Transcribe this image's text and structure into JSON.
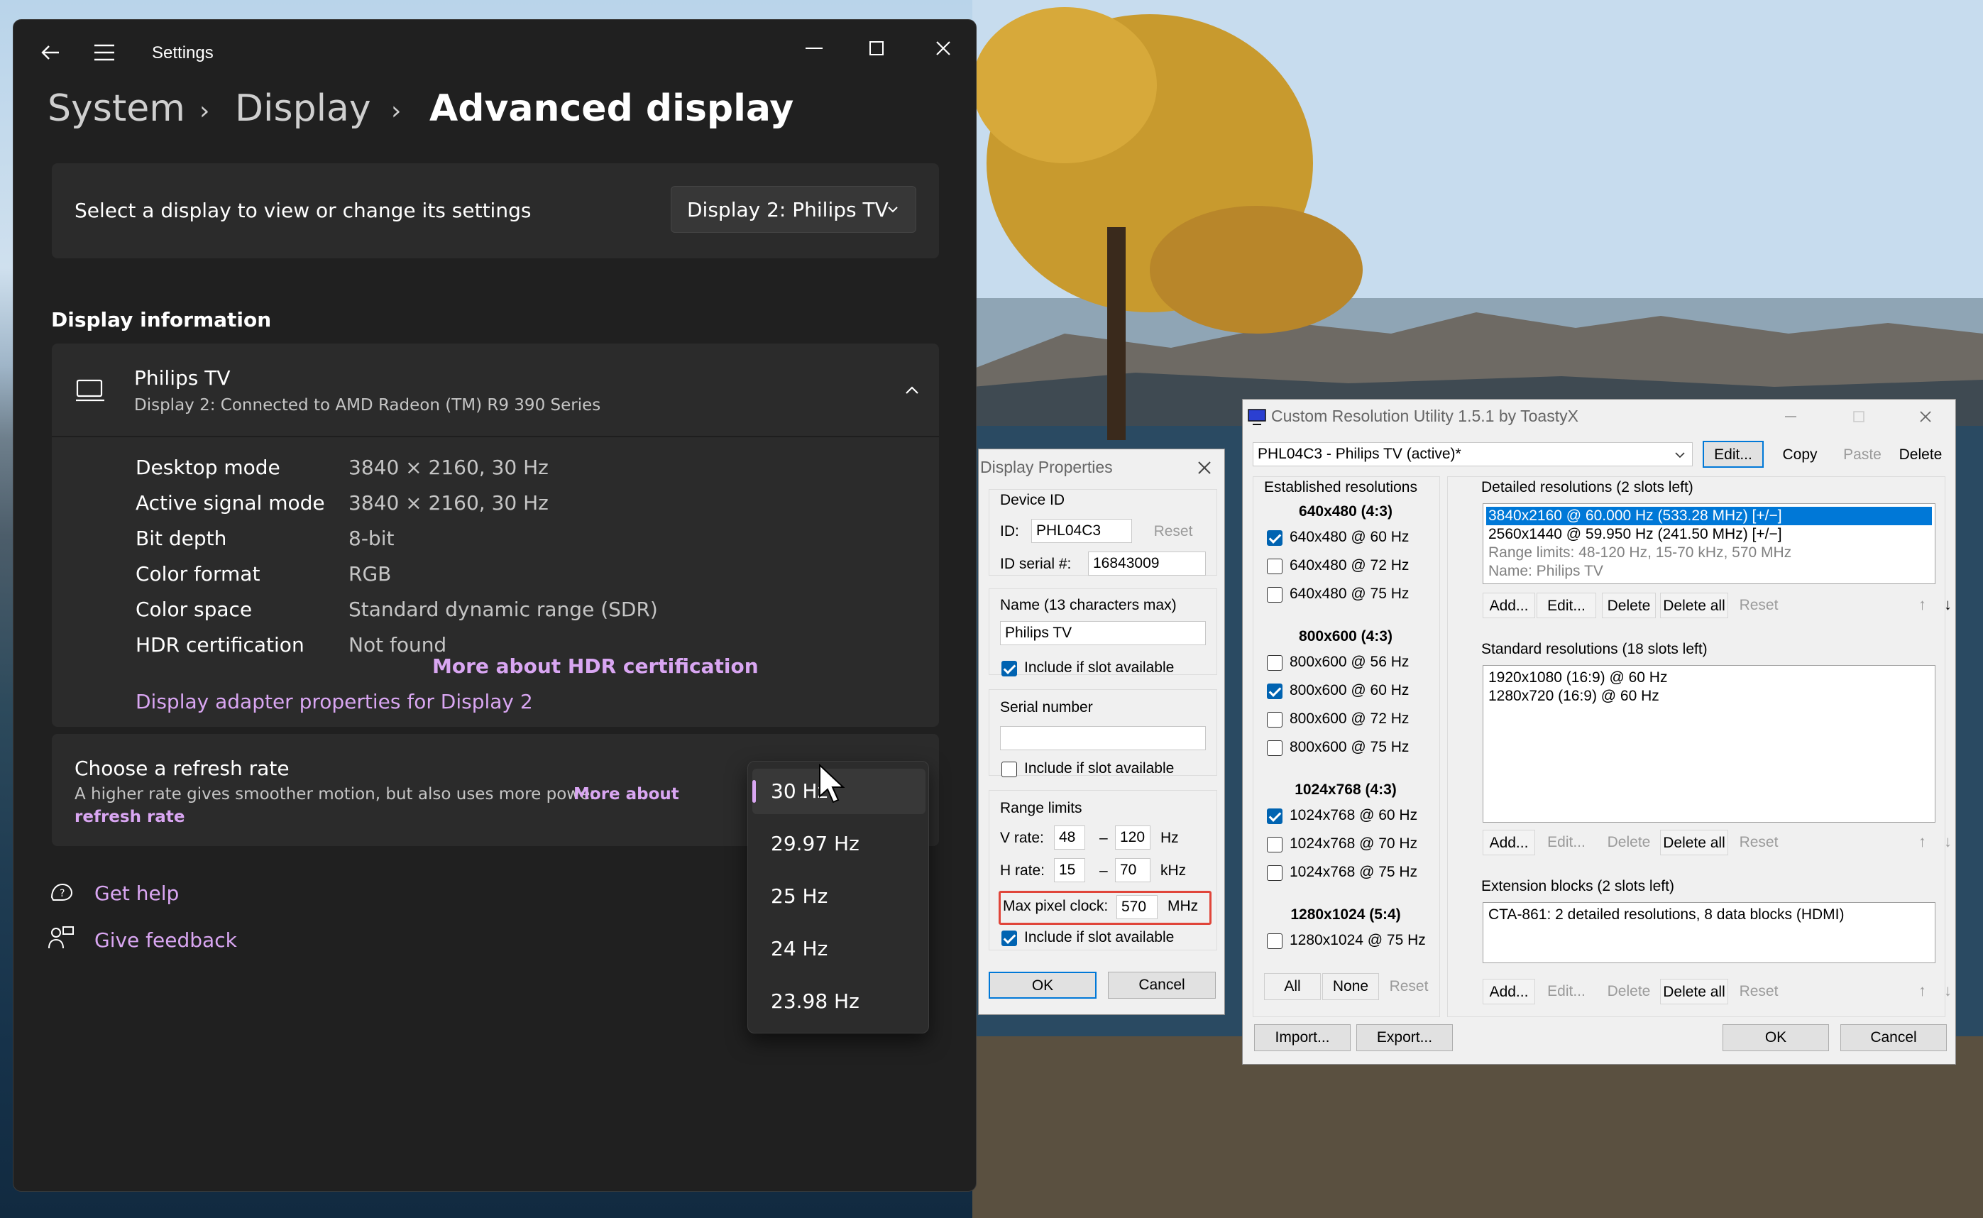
{
  "settings": {
    "title": "Settings",
    "breadcrumb": [
      "System",
      "Display",
      "Advanced display"
    ],
    "select_display": {
      "label": "Select a display to view or change its settings",
      "value": "Display 2: Philips TV"
    },
    "section_title": "Display information",
    "display": {
      "name": "Philips TV",
      "subtitle": "Display 2: Connected to AMD Radeon (TM) R9 390 Series"
    },
    "info": [
      {
        "label": "Desktop mode",
        "value": "3840 × 2160, 30 Hz"
      },
      {
        "label": "Active signal mode",
        "value": "3840 × 2160, 30 Hz"
      },
      {
        "label": "Bit depth",
        "value": "8-bit"
      },
      {
        "label": "Color format",
        "value": "RGB"
      },
      {
        "label": "Color space",
        "value": "Standard dynamic range (SDR)"
      },
      {
        "label": "HDR certification",
        "value": "Not found"
      }
    ],
    "hdr_link": "More about HDR certification",
    "adapter_link": "Display adapter properties for Display 2",
    "refresh": {
      "title": "Choose a refresh rate",
      "desc": "A higher rate gives smoother motion, but also uses more power",
      "link1": "More about",
      "link2": "refresh rate"
    },
    "refresh_options": [
      "30 Hz",
      "29.97 Hz",
      "25 Hz",
      "24 Hz",
      "23.98 Hz"
    ],
    "refresh_selected": "30 Hz",
    "get_help": "Get help",
    "give_feedback": "Give feedback",
    "accent": "#d9a6f2"
  },
  "display_props": {
    "title": "Display Properties",
    "device_id_group": "Device ID",
    "id_label": "ID:",
    "id_value": "PHL04C3",
    "reset": "Reset",
    "serial_label": "ID serial #:",
    "serial_value": "16843009",
    "name_group": "Name (13 characters max)",
    "name_value": "Philips TV",
    "include": "Include if slot available",
    "serial_group": "Serial number",
    "serial_number_value": "",
    "range_group": "Range limits",
    "vrate_label": "V rate:",
    "vrate_min": "48",
    "vrate_max": "120",
    "vrate_unit": "Hz",
    "hrate_label": "H rate:",
    "hrate_min": "15",
    "hrate_max": "70",
    "hrate_unit": "kHz",
    "dash": "–",
    "pixel_label": "Max pixel clock:",
    "pixel_value": "570",
    "pixel_unit": "MHz",
    "ok": "OK",
    "cancel": "Cancel"
  },
  "cru": {
    "title": "Custom Resolution Utility 1.5.1 by ToastyX",
    "monitor": "PHL04C3 - Philips TV (active)*",
    "top_buttons": [
      "Edit...",
      "Copy",
      "Paste",
      "Delete"
    ],
    "established_title": "Established resolutions",
    "established_groups": [
      {
        "header": "640x480 (4:3)",
        "items": [
          {
            "label": "640x480 @ 60 Hz",
            "checked": true
          },
          {
            "label": "640x480 @ 72 Hz",
            "checked": false
          },
          {
            "label": "640x480 @ 75 Hz",
            "checked": false
          }
        ]
      },
      {
        "header": "800x600 (4:3)",
        "items": [
          {
            "label": "800x600 @ 56 Hz",
            "checked": false
          },
          {
            "label": "800x600 @ 60 Hz",
            "checked": true
          },
          {
            "label": "800x600 @ 72 Hz",
            "checked": false
          },
          {
            "label": "800x600 @ 75 Hz",
            "checked": false
          }
        ]
      },
      {
        "header": "1024x768 (4:3)",
        "items": [
          {
            "label": "1024x768 @ 60 Hz",
            "checked": true
          },
          {
            "label": "1024x768 @ 70 Hz",
            "checked": false
          },
          {
            "label": "1024x768 @ 75 Hz",
            "checked": false
          }
        ]
      },
      {
        "header": "1280x1024 (5:4)",
        "items": [
          {
            "label": "1280x1024 @ 75 Hz",
            "checked": false
          }
        ]
      }
    ],
    "est_buttons": [
      "All",
      "None",
      "Reset"
    ],
    "detailed_title": "Detailed resolutions (2 slots left)",
    "detailed": [
      "3840x2160 @ 60.000 Hz (533.28 MHz) [+/−]",
      "2560x1440 @ 59.950 Hz (241.50 MHz) [+/−]",
      "Range limits: 48-120 Hz, 15-70 kHz, 570 MHz",
      "Name: Philips TV"
    ],
    "standard_title": "Standard resolutions (18 slots left)",
    "standard": [
      "1920x1080 (16:9) @ 60 Hz",
      "1280x720 (16:9) @ 60 Hz"
    ],
    "extension_title": "Extension blocks (2 slots left)",
    "extension": [
      "CTA-861: 2 detailed resolutions, 8 data blocks (HDMI)"
    ],
    "list_buttons": [
      "Add...",
      "Edit...",
      "Delete",
      "Delete all",
      "Reset"
    ],
    "bottom_buttons": [
      "Import...",
      "Export...",
      "OK",
      "Cancel"
    ]
  }
}
